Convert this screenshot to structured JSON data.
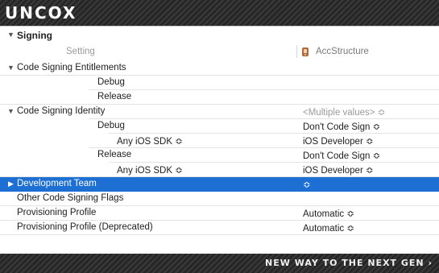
{
  "banner": {
    "logo": "UNCOX",
    "tagline": "NEW WAY TO THE NEXT GEN ›"
  },
  "section": {
    "title": "Signing",
    "col_setting": "Setting",
    "col_target": "AccStructure",
    "target_icon": "app-target-icon"
  },
  "rows": [
    {
      "label": "Code Signing Entitlements",
      "value": ""
    },
    {
      "label": "Debug",
      "value": ""
    },
    {
      "label": "Release",
      "value": ""
    },
    {
      "label": "Code Signing Identity",
      "value": "<Multiple values> ≎"
    },
    {
      "label": "Debug",
      "value": "Don't Code Sign ≎"
    },
    {
      "label": "Any iOS SDK ≎",
      "value": "iOS Developer ≎"
    },
    {
      "label": "Release",
      "value": "Don't Code Sign ≎"
    },
    {
      "label": "Any iOS SDK ≎",
      "value": "iOS Developer ≎"
    },
    {
      "label": "Development Team",
      "value": "≎"
    },
    {
      "label": "Other Code Signing Flags",
      "value": ""
    },
    {
      "label": "Provisioning Profile",
      "value": "Automatic ≎"
    },
    {
      "label": "Provisioning Profile (Deprecated)",
      "value": "Automatic ≎"
    }
  ],
  "colors": {
    "selection": "#1d6fd4",
    "banner": "#2a2a2a"
  }
}
